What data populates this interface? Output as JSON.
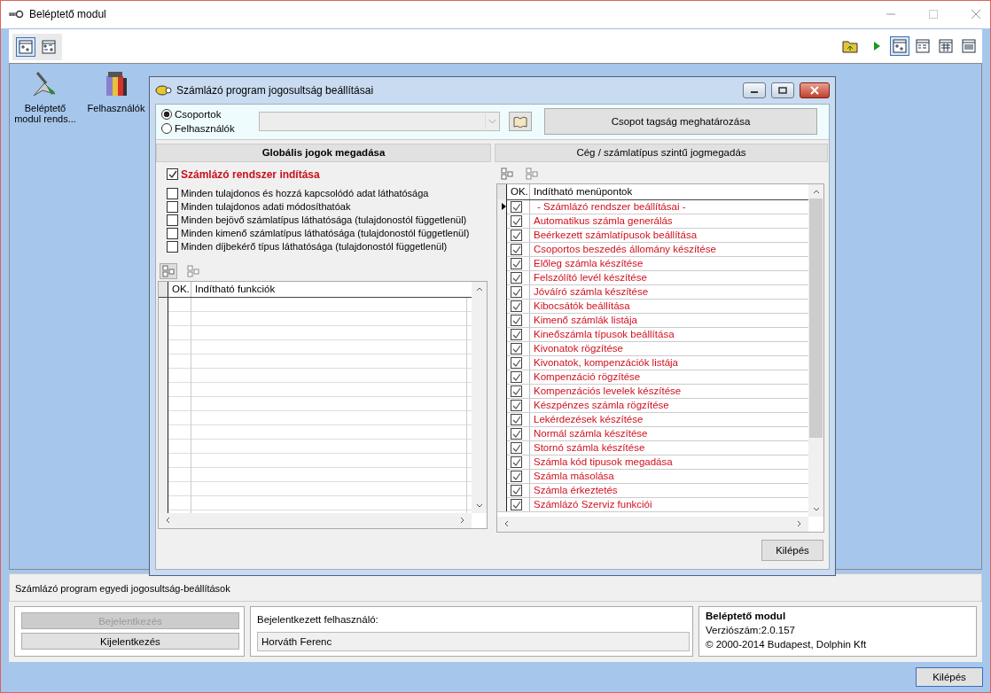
{
  "window": {
    "title": "Beléptető modul"
  },
  "toolbar": {
    "view_buttons": [
      {
        "selected": true
      },
      {
        "selected": false
      }
    ],
    "right_views": [
      {
        "selected": true
      },
      {
        "selected": false
      },
      {
        "selected": false
      },
      {
        "selected": false
      }
    ]
  },
  "desktop_icons": [
    {
      "label": "Beléptető modul rends...",
      "kind": "tool"
    },
    {
      "label": "Felhasználók",
      "kind": "users"
    }
  ],
  "dialog": {
    "title": "Számlázó program jogosultság beállításai",
    "modes": [
      {
        "label": "Csoportok",
        "selected": true
      },
      {
        "label": "Felhasználók",
        "selected": false
      }
    ],
    "combo": {
      "disabled": true
    },
    "group_button": "Csopot tagság meghatározása",
    "global_header": "Globális jogok megadása",
    "company_header": "Cég / számlatípus szintű jogmegadás",
    "main_right": {
      "label": "Számlázó rendszer indítása",
      "checked": true
    },
    "global_rights": [
      {
        "label": "Minden tulajdonos és hozzá kapcsolódó adat láthatósága",
        "checked": false
      },
      {
        "label": "Minden tulajdonos adati módosíthatóak",
        "checked": false
      },
      {
        "label": "Minden bejövő számlatípus láthatósága (tulajdonostól függetlenül)",
        "checked": false
      },
      {
        "label": "Minden kimenő számlatípus láthatósága (tulajdonostól függetlenül)",
        "checked": false
      },
      {
        "label": "Minden díjbekérő típus láthatósága (tulajdonostól függetlenül)",
        "checked": false
      }
    ],
    "left_grid": {
      "columns": [
        "OK.",
        "Indítható funkciók"
      ]
    },
    "right_grid": {
      "columns": [
        "OK.",
        "Indítható menüpontok"
      ],
      "rows": [
        {
          "label": "- Számlázó rendszer beállításai -",
          "checked": true,
          "current": true
        },
        {
          "label": "Automatikus számla generálás",
          "checked": true,
          "current": false
        },
        {
          "label": "Beérkezett számlatípusok beállítása",
          "checked": true,
          "current": false
        },
        {
          "label": "Csoportos beszedés állomány készítése",
          "checked": true,
          "current": false
        },
        {
          "label": "Előleg számla készítése",
          "checked": true,
          "current": false
        },
        {
          "label": "Felszólító levél készítése",
          "checked": true,
          "current": false
        },
        {
          "label": "Jóváíró számla készítése",
          "checked": true,
          "current": false
        },
        {
          "label": "Kibocsátók beállítása",
          "checked": true,
          "current": false
        },
        {
          "label": "Kimenő számlák listája",
          "checked": true,
          "current": false
        },
        {
          "label": "Kineőszámla típusok beállítása",
          "checked": true,
          "current": false
        },
        {
          "label": "Kivonatok rögzítése",
          "checked": true,
          "current": false
        },
        {
          "label": "Kivonatok, kompenzációk listája",
          "checked": true,
          "current": false
        },
        {
          "label": "Kompenzáció rögzítése",
          "checked": true,
          "current": false
        },
        {
          "label": "Kompenzációs levelek készítése",
          "checked": true,
          "current": false
        },
        {
          "label": "Készpénzes számla rögzítése",
          "checked": true,
          "current": false
        },
        {
          "label": "Lekérdezések készítése",
          "checked": true,
          "current": false
        },
        {
          "label": "Normál számla készítése",
          "checked": true,
          "current": false
        },
        {
          "label": "Stornó számla készítése",
          "checked": true,
          "current": false
        },
        {
          "label": "Számla kód tipusok megadása",
          "checked": true,
          "current": false
        },
        {
          "label": "Számla másolása",
          "checked": true,
          "current": false
        },
        {
          "label": "Számla érkeztetés",
          "checked": true,
          "current": false
        },
        {
          "label": "Számlázó Szerviz funkciói",
          "checked": true,
          "current": false
        }
      ]
    },
    "exit_button": "Kilépés"
  },
  "status_text": "Számlázó program egyedi jogosultság-beállítások",
  "login_button": {
    "label": "Bejelentkezés",
    "disabled": true
  },
  "logout_button": {
    "label": "Kijelentkezés",
    "disabled": false
  },
  "logged_user_label": "Bejelentkezett felhasználó:",
  "logged_user": "Horváth Ferenc",
  "app_info": {
    "name": "Beléptető modul",
    "version": "Verziószám:2.0.157",
    "copyright": "© 2000-2014 Budapest, Dolphin Kft"
  },
  "exit_button": "Kilépés"
}
